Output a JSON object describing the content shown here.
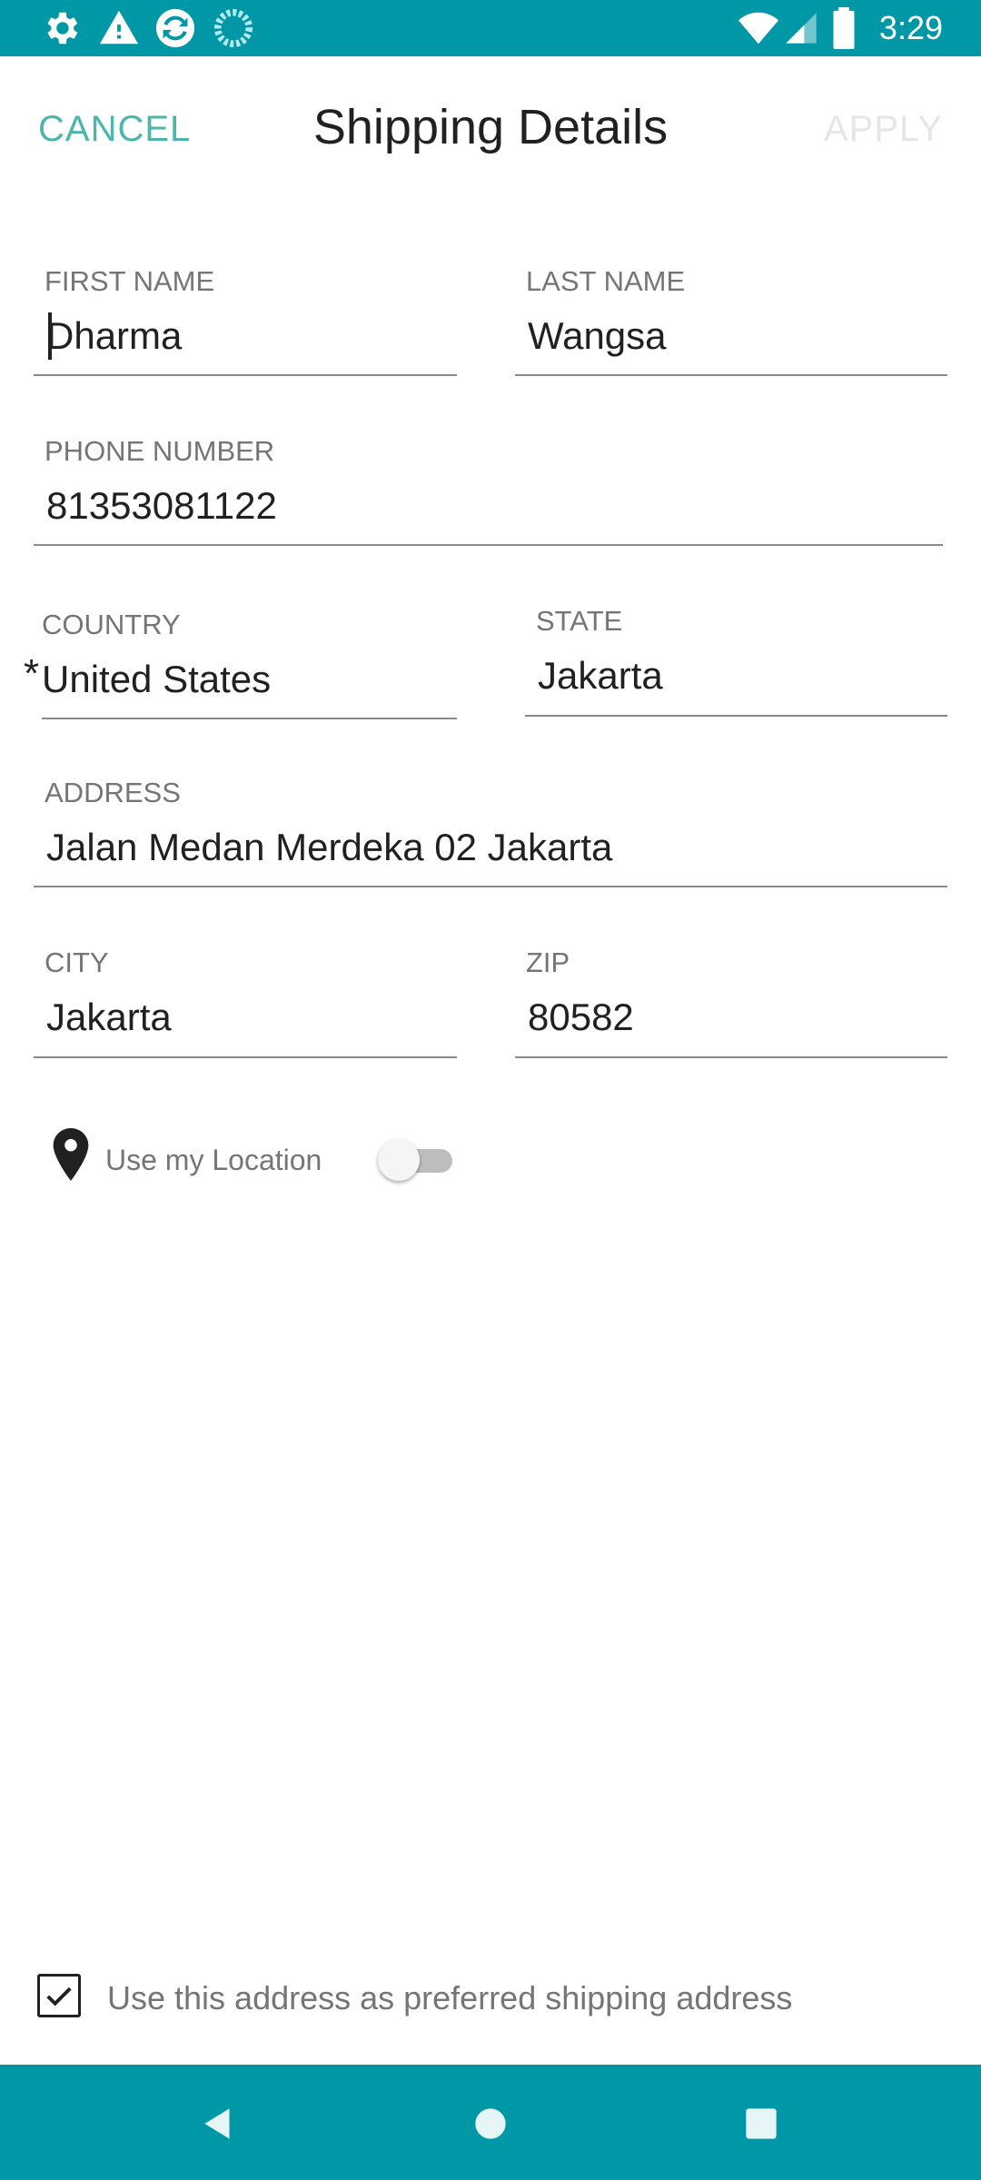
{
  "status_bar": {
    "time": "3:29",
    "left_icons": [
      "settings-icon",
      "warning-icon",
      "sync-app-icon",
      "loading-icon"
    ],
    "right_icons": [
      "wifi-icon",
      "signal-icon",
      "battery-icon"
    ]
  },
  "app_bar": {
    "cancel_label": "CANCEL",
    "title": "Shipping Details",
    "apply_label": "APPLY"
  },
  "form": {
    "first_name": {
      "label": "FIRST NAME",
      "value": "Dharma"
    },
    "last_name": {
      "label": "LAST NAME",
      "value": "Wangsa"
    },
    "phone": {
      "label": "PHONE NUMBER",
      "value": "81353081122"
    },
    "country": {
      "label": "COUNTRY",
      "value": "United States",
      "required_mark": "*"
    },
    "state": {
      "label": "STATE",
      "value": "Jakarta"
    },
    "address": {
      "label": "ADDRESS",
      "value": "Jalan Medan Merdeka 02 Jakarta"
    },
    "city": {
      "label": "CITY",
      "value": "Jakarta"
    },
    "zip": {
      "label": "ZIP",
      "value": "80582"
    }
  },
  "location": {
    "label": "Use my Location",
    "enabled": false
  },
  "preferred": {
    "label": "Use this address as preferred shipping address",
    "checked": true
  },
  "colors": {
    "accent": "#0097a7",
    "cancel": "#4db6ac",
    "apply_disabled": "#e6e6e6",
    "label_gray": "#757575"
  },
  "nav_bar": {
    "icons": [
      "back-icon",
      "home-icon",
      "recents-icon"
    ]
  }
}
